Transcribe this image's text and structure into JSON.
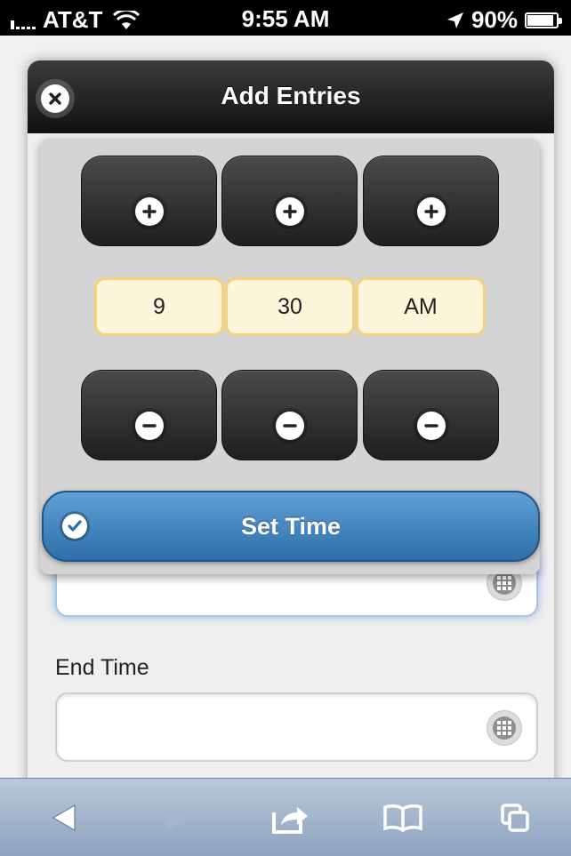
{
  "status_bar": {
    "carrier": "AT&T",
    "time": "9:55 AM",
    "battery": "90%",
    "battery_level": 0.9,
    "signal_icon": "signal-bars-icon",
    "wifi_icon": "wifi-icon",
    "location_icon": "location-arrow-icon"
  },
  "dialog": {
    "title": "Add Entries",
    "close_icon": "close-icon"
  },
  "time_picker": {
    "hour": "9",
    "minute": "30",
    "ampm": "AM",
    "set_label": "Set Time",
    "increment_icon": "plus-icon",
    "decrement_icon": "minus-icon",
    "highlight_color": "#f3d27a",
    "accent_color": "#3b7fbf"
  },
  "form": {
    "end_time_label": "End Time",
    "start_time_value": "",
    "end_time_value": ""
  },
  "toolbar": {
    "items": [
      "back-icon",
      "forward-icon",
      "share-icon",
      "bookmarks-icon",
      "tabs-icon"
    ]
  }
}
